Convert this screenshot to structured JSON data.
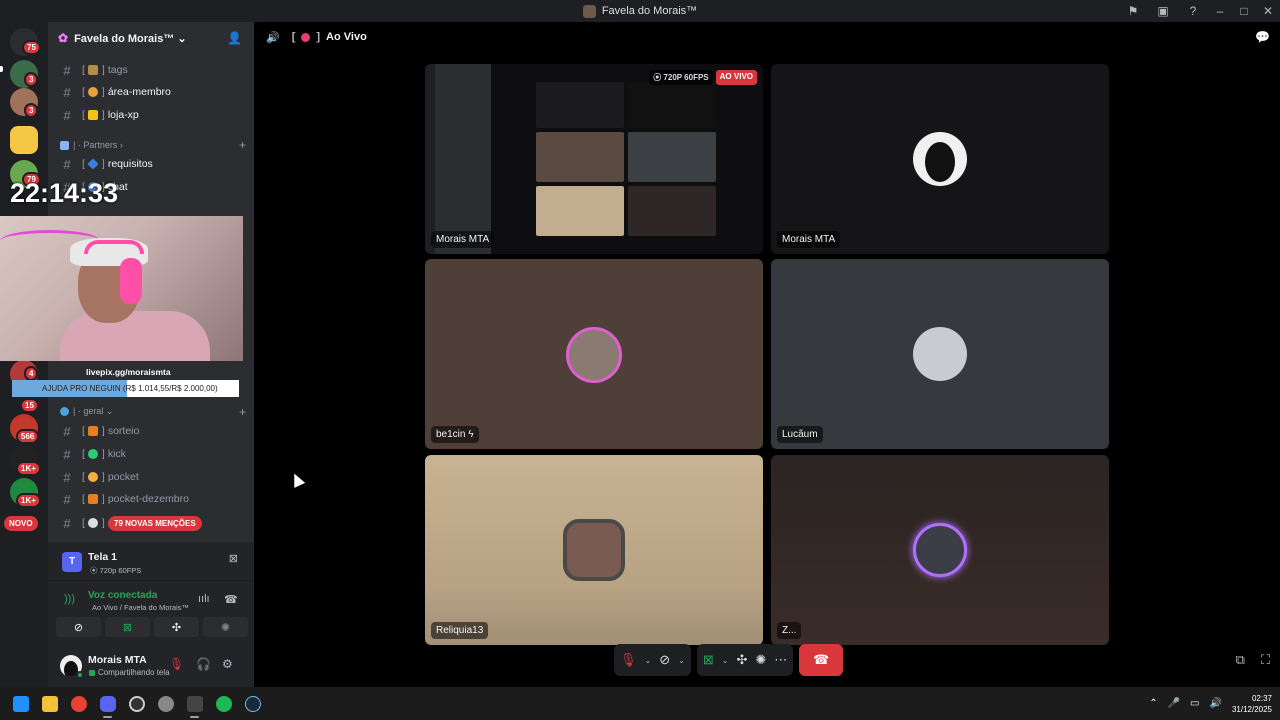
{
  "window": {
    "title": "Favela do Morais™"
  },
  "server": {
    "name": "Favela do Morais™ ⌄"
  },
  "rail": {
    "badges": [
      {
        "text": "75"
      },
      {
        "text": "3"
      },
      {
        "text": "3"
      },
      {
        "text": "79"
      },
      {
        "text": "4"
      },
      {
        "text": "15"
      },
      {
        "text": "566"
      },
      {
        "text": "1K+"
      },
      {
        "text": "1K+"
      }
    ],
    "novo": "NOVO"
  },
  "channels": {
    "top": [
      {
        "name": "tags",
        "bright": false
      },
      {
        "name": "área-membro",
        "bright": true
      },
      {
        "name": "loja-xp",
        "bright": true
      }
    ],
    "partners_category": "| · Partners ›",
    "partners": [
      {
        "name": "requisitos"
      },
      {
        "name": "chat"
      }
    ],
    "geral_category": "| · geral ⌄",
    "geral": [
      {
        "name": "sorteio"
      },
      {
        "name": "kick"
      },
      {
        "name": "pocket"
      },
      {
        "name": "pocket-dezembro"
      }
    ],
    "mentions": "79 NOVAS MENÇÕES"
  },
  "overlay": {
    "clock": "22:14:33",
    "livepix_url": "livepix.gg/moraismta",
    "goal_text": "AJUDA PRO NEGUIN (R$ 1.014,55/R$ 2.000,00)",
    "goal_fraction": 0.507
  },
  "stream_panel": {
    "thumb": "T",
    "name": "Tela 1",
    "quality": "⦿ 720p 60FPS"
  },
  "voice_panel": {
    "status": "Voz conectada",
    "channel": "Ao Vivo / Favela do Morais™"
  },
  "user": {
    "name": "Morais MTA",
    "status": "Compartilhando tela"
  },
  "main": {
    "channel": "Ao Vivo",
    "tiles": [
      {
        "label": "Morais MTA",
        "quality": "⦿ 720P 60FPS",
        "live": "AO VIVO"
      },
      {
        "label": "Morais MTA"
      },
      {
        "label": "be1cin ϟ"
      },
      {
        "label": "Lucãum"
      },
      {
        "label": "Reliquia13"
      },
      {
        "label": "Z..."
      }
    ]
  },
  "taskbar": {
    "time": "02:37",
    "date": "31/12/2025"
  },
  "colors": {
    "accent": "#5865f2",
    "danger": "#da373c",
    "online": "#23a55a"
  }
}
